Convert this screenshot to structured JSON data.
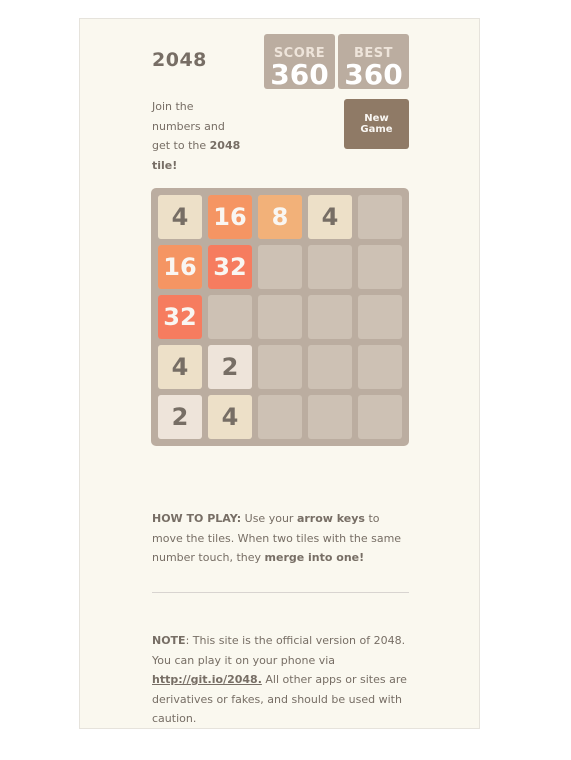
{
  "header": {
    "title": "2048",
    "score_label": "SCORE",
    "score_value": "360",
    "best_label": "BEST",
    "best_value": "360"
  },
  "intro": {
    "prefix": "Join the numbers and get to the ",
    "bold": "2048 tile!"
  },
  "new_game_label": "New Game",
  "board": {
    "size": 5,
    "rows": [
      [
        "4",
        "16",
        "8",
        "4",
        ""
      ],
      [
        "16",
        "32",
        "",
        "",
        ""
      ],
      [
        "32",
        "",
        "",
        "",
        ""
      ],
      [
        "4",
        "2",
        "",
        "",
        ""
      ],
      [
        "2",
        "4",
        "",
        "",
        ""
      ]
    ],
    "tile_colors": {
      "2": "#eee4da",
      "4": "#ede0c8",
      "8": "#f2b179",
      "16": "#f59563",
      "32": "#f67c5f"
    }
  },
  "how_to_play": {
    "heading": "HOW TO PLAY:",
    "text1": " Use your ",
    "bold1": "arrow keys",
    "text2": " to move the tiles. When two tiles with the same number touch, they ",
    "bold2": "merge into one!"
  },
  "note": {
    "heading": "NOTE",
    "text1": ": This site is the official version of 2048. You can play it on your phone via ",
    "link": "http://git.io/2048.",
    "text2": " All other apps or sites are derivatives or fakes, and should be used with caution."
  }
}
